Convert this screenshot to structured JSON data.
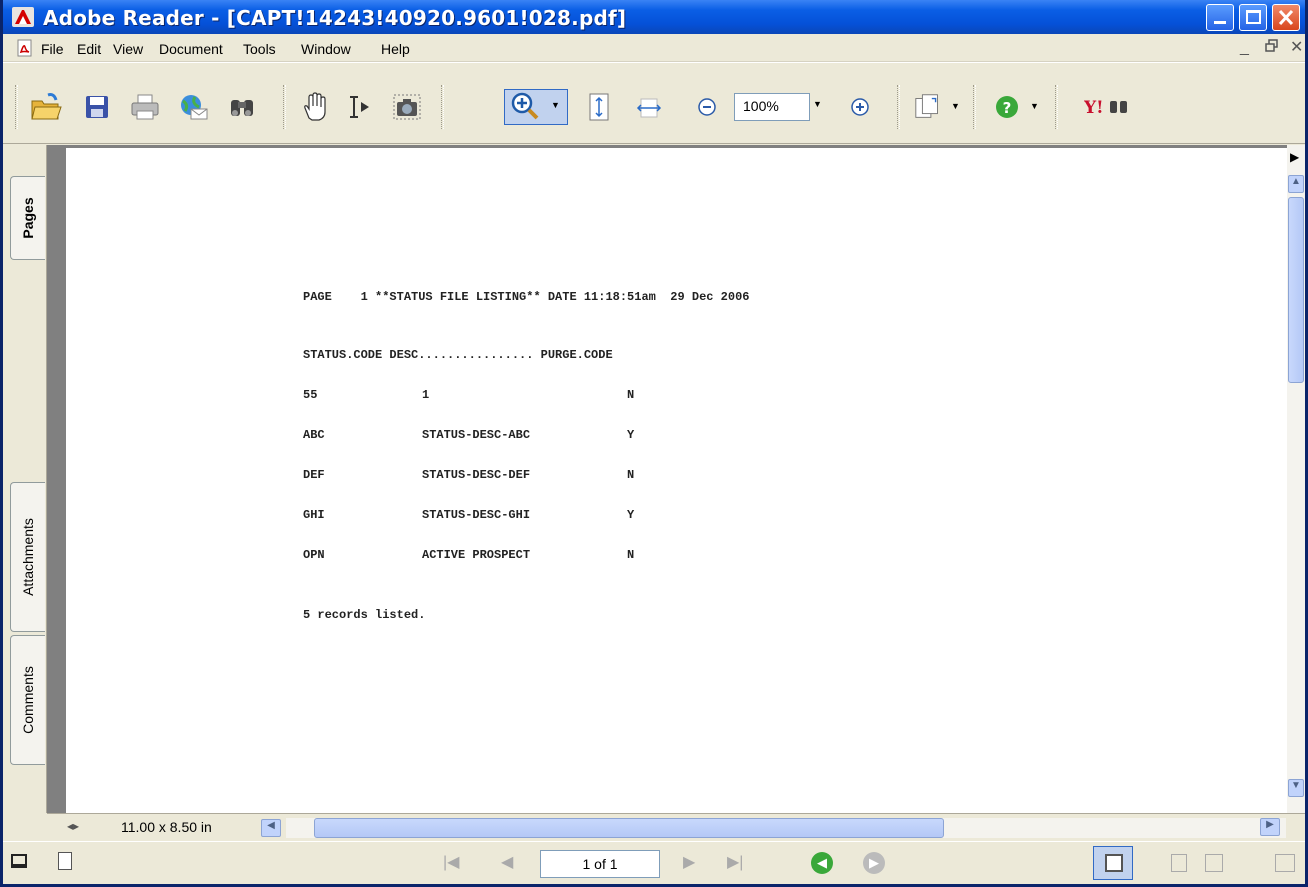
{
  "window": {
    "title": "Adobe Reader - [CAPT!14243!40920.9601!028.pdf]"
  },
  "menubar": {
    "items": [
      "File",
      "Edit",
      "View",
      "Document",
      "Tools",
      "Window",
      "Help"
    ]
  },
  "toolbar": {
    "zoom_value": "100%"
  },
  "side_tabs": {
    "pages": "Pages",
    "attachments": "Attachments",
    "comments": "Comments"
  },
  "document": {
    "header": "PAGE    1 **STATUS FILE LISTING** DATE 11:18:51am  29 Dec 2006",
    "columns": "STATUS.CODE DESC................ PURGE.CODE",
    "rows": [
      {
        "code": "55",
        "desc": "1",
        "purge": "N"
      },
      {
        "code": "ABC",
        "desc": "STATUS-DESC-ABC",
        "purge": "Y"
      },
      {
        "code": "DEF",
        "desc": "STATUS-DESC-DEF",
        "purge": "N"
      },
      {
        "code": "GHI",
        "desc": "STATUS-DESC-GHI",
        "purge": "Y"
      },
      {
        "code": "OPN",
        "desc": "ACTIVE PROSPECT",
        "purge": "N"
      }
    ],
    "footer": "5 records listed."
  },
  "bottom": {
    "page_size": "11.00 x 8.50 in"
  },
  "statusbar": {
    "page_indicator": "1 of 1"
  },
  "colors": {
    "titlebar": "#0551d8",
    "chrome": "#ece9d8",
    "doc_background": "#808080"
  }
}
